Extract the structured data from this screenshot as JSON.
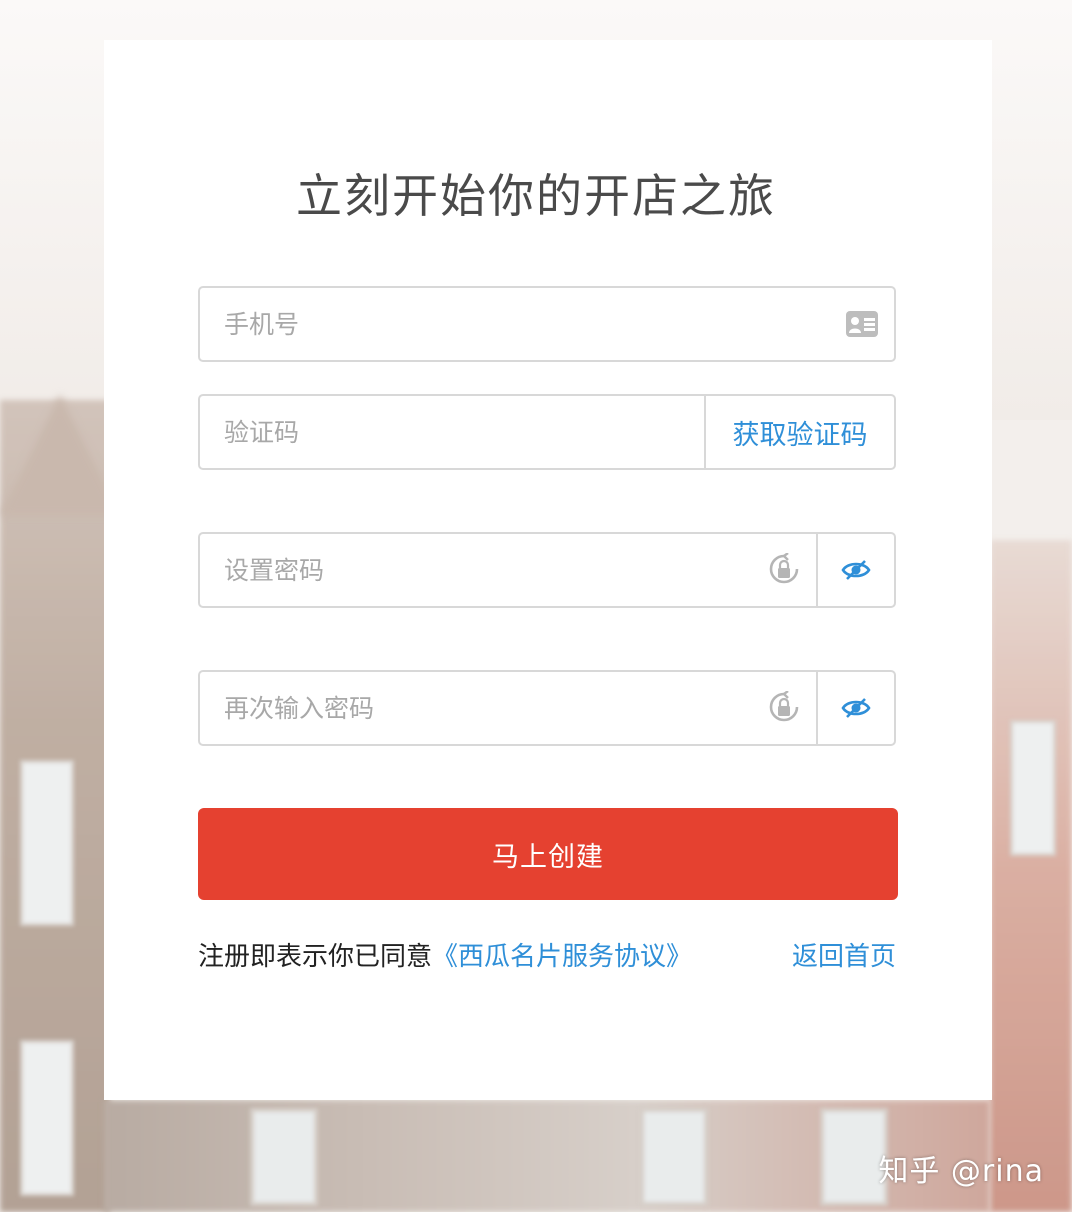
{
  "title": "立刻开始你的开店之旅",
  "fields": {
    "phone": {
      "placeholder": "手机号",
      "value": ""
    },
    "code": {
      "placeholder": "验证码",
      "value": "",
      "button_label": "获取验证码"
    },
    "password": {
      "placeholder": "设置密码",
      "value": ""
    },
    "password_confirm": {
      "placeholder": "再次输入密码",
      "value": ""
    }
  },
  "submit_label": "马上创建",
  "agreement": {
    "prefix": "注册即表示你已同意",
    "link": "《西瓜名片服务协议》"
  },
  "home_link": "返回首页",
  "watermark": "知乎 @rina",
  "colors": {
    "accent": "#e54130",
    "link": "#2f8fd8",
    "border": "#d8d8d8",
    "placeholder": "#a8a8a8"
  },
  "icons": {
    "phone": "id-card-icon",
    "password": "lock-refresh-icon",
    "toggle": "eye-icon"
  }
}
